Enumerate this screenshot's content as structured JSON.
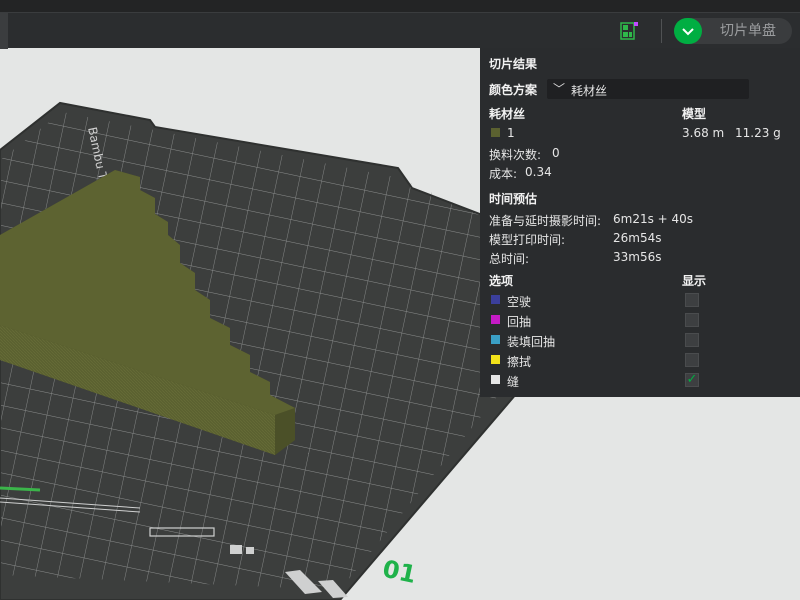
{
  "toolbar": {
    "slice_button_label": "切片单盘",
    "layout_icon": "layout-grid-icon",
    "dropdown_icon": "chevron-down-icon",
    "accent": "#00ae42"
  },
  "viewport": {
    "plate_text": "Bambu Textured PEI",
    "plate_number": "01",
    "model_color": "#5b6130"
  },
  "panel": {
    "title": "切片结果",
    "color_scheme_label": "颜色方案",
    "color_scheme_value": "耗材丝",
    "filament_header": "耗材丝",
    "model_header": "模型",
    "filament": {
      "index": "1",
      "length": "3.68 m",
      "weight": "11.23 g",
      "color": "#5b6130"
    },
    "changes_label": "换料次数:",
    "changes_value": "0",
    "cost_label": "成本:",
    "cost_value": "0.34",
    "time_header": "时间预估",
    "prep_label": "准备与延时摄影时间:",
    "prep_value": "6m21s + 40s",
    "print_label": "模型打印时间:",
    "print_value": "26m54s",
    "total_label": "总时间:",
    "total_value": "33m56s",
    "options_header": "选项",
    "display_header": "显示",
    "options": [
      {
        "label": "空驶",
        "color": "#3b3f9c",
        "checked": false
      },
      {
        "label": "回抽",
        "color": "#c51bc6",
        "checked": false
      },
      {
        "label": "装填回抽",
        "color": "#3a9fc5",
        "checked": false
      },
      {
        "label": "擦拭",
        "color": "#f2e21a",
        "checked": false
      },
      {
        "label": "缝",
        "color": "#e6e6e6",
        "checked": true
      }
    ]
  }
}
